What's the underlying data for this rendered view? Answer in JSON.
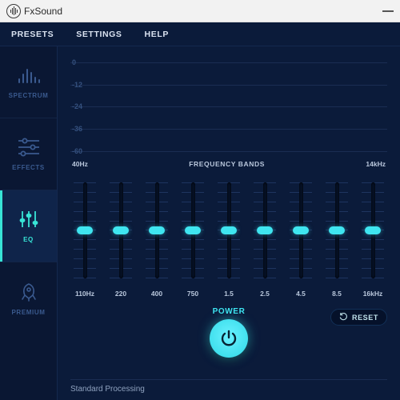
{
  "app": {
    "name": "FxSound"
  },
  "menu": {
    "presets": "PRESETS",
    "settings": "SETTINGS",
    "help": "HELP"
  },
  "sidebar": {
    "items": [
      {
        "id": "spectrum",
        "label": "SPECTRUM",
        "icon": "spectrum-icon",
        "active": false
      },
      {
        "id": "effects",
        "label": "EFFECTS",
        "icon": "sliders-horizontal-icon",
        "active": false
      },
      {
        "id": "eq",
        "label": "EQ",
        "icon": "eq-sliders-icon",
        "active": true
      },
      {
        "id": "premium",
        "label": "PREMIUM",
        "icon": "rocket-icon",
        "active": false
      }
    ]
  },
  "eq": {
    "db_ticks": [
      "0",
      "-12",
      "-24",
      "-36",
      "-60"
    ],
    "freq_header": {
      "left": "40Hz",
      "mid": "FREQUENCY BANDS",
      "right": "14kHz"
    },
    "bands": [
      {
        "label": "110Hz",
        "value_pct": 50
      },
      {
        "label": "220",
        "value_pct": 50
      },
      {
        "label": "400",
        "value_pct": 50
      },
      {
        "label": "750",
        "value_pct": 50
      },
      {
        "label": "1.5",
        "value_pct": 50
      },
      {
        "label": "2.5",
        "value_pct": 50
      },
      {
        "label": "4.5",
        "value_pct": 50
      },
      {
        "label": "8.5",
        "value_pct": 50
      },
      {
        "label": "16kHz",
        "value_pct": 50
      }
    ],
    "power_label": "POWER",
    "reset_label": "RESET",
    "status": "Standard Processing"
  },
  "colors": {
    "accent": "#3fe5f0",
    "bg": "#0b1b3a",
    "sidebar_inactive": "#3a5a8f"
  }
}
